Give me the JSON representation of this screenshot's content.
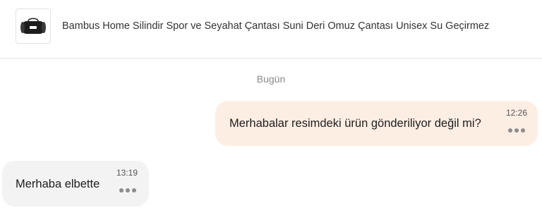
{
  "product": {
    "title": "Bambus Home Silindir Spor ve Seyahat Çantası Suni Deri Omuz Çantası Unisex Su Geçirmez",
    "image_icon": "duffel-bag-image"
  },
  "conversation": {
    "date_separator": "Bugün",
    "messages": [
      {
        "direction": "outgoing",
        "text": "Merhabalar resimdeki ürün gönderiliyor değil mi?",
        "time": "12:26"
      },
      {
        "direction": "incoming",
        "text": "Merhaba elbette",
        "time": "13:19"
      }
    ]
  },
  "colors": {
    "outgoing_bubble": "#fdeee4",
    "incoming_bubble": "#f3f3f3",
    "muted_text": "#8a8a8a"
  },
  "icons": {
    "message_menu": "more-horizontal-icon"
  }
}
